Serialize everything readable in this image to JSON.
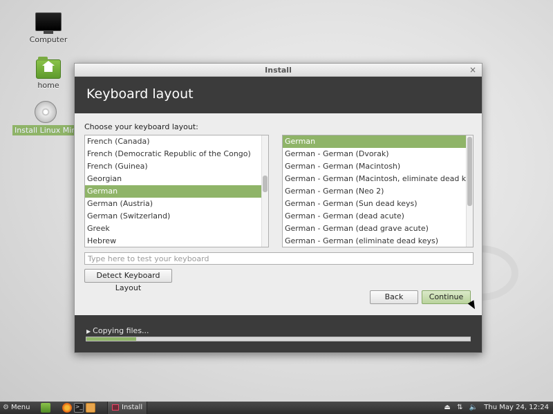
{
  "desktop": {
    "icons": [
      {
        "label": "Computer",
        "icon": "monitor-icon"
      },
      {
        "label": "home",
        "icon": "home-folder-icon"
      },
      {
        "label": "Install Linux Mint",
        "icon": "install-disc-icon"
      }
    ]
  },
  "window": {
    "title": "Install",
    "close_glyph": "×",
    "header": "Keyboard layout",
    "choose_label": "Choose your keyboard layout:",
    "layouts": [
      "French (Canada)",
      "French (Democratic Republic of the Congo)",
      "French (Guinea)",
      "Georgian",
      "German",
      "German (Austria)",
      "German (Switzerland)",
      "Greek",
      "Hebrew"
    ],
    "layouts_selected": "German",
    "variants": [
      "German",
      "German - German (Dvorak)",
      "German - German (Macintosh)",
      "German - German (Macintosh, eliminate dead keys)",
      "German - German (Neo 2)",
      "German - German (Sun dead keys)",
      "German - German (dead acute)",
      "German - German (dead grave acute)",
      "German - German (eliminate dead keys)"
    ],
    "variants_selected": "German",
    "test_input": {
      "value": "",
      "placeholder": "Type here to test your keyboard"
    },
    "detect_button": "Detect Keyboard Layout",
    "back_button": "Back",
    "continue_button": "Continue",
    "status": "Copying files...",
    "progress_fraction": 0.13,
    "accent_color": "#8fb468"
  },
  "taskbar": {
    "menu_label": "Menu",
    "menu_icon": "gear-icon",
    "launchers": [
      "show-desktop-icon",
      "firefox-icon",
      "terminal-icon",
      "files-icon"
    ],
    "window_button": "Install",
    "tray_icons": [
      "removable-drive-icon",
      "network-icon",
      "volume-icon"
    ],
    "clock": "Thu May 24, 12:24"
  }
}
